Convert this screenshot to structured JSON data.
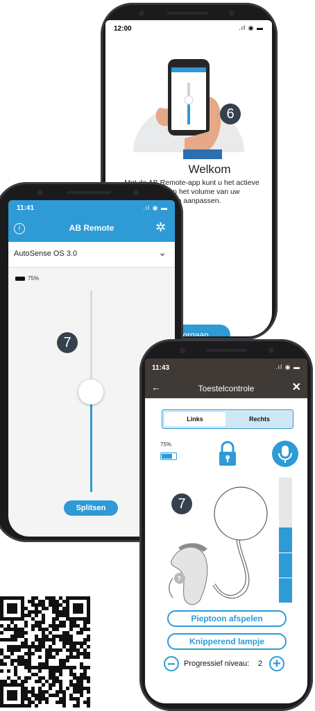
{
  "colors": {
    "accent": "#2e9ad6",
    "header_dark": "#403a36",
    "callout": "#35424d"
  },
  "phone1": {
    "time": "12:00",
    "welcome_title": "Welkom",
    "welcome_text_line1": "Met de AB Remote-app kunt u het actieve",
    "welcome_text_line2": "…ellen en het volume van uw",
    "welcome_text_line3": "…llen aanpassen.",
    "callout": "6",
    "continue_button": "Doorgaan"
  },
  "phone2": {
    "time": "11:41",
    "app_title": "AB Remote",
    "program_select": "AutoSense OS 3.0",
    "battery_pct": "75%",
    "volume_level": 0.58,
    "callout": "7",
    "split_button": "Splitsen",
    "icons": [
      "info-icon",
      "settings-gear-icon",
      "chevron-down-icon",
      "battery-icon"
    ]
  },
  "phone3": {
    "time": "11:43",
    "title": "Toestelcontrole",
    "tabs": [
      "Links",
      "Rechts"
    ],
    "active_tab": "Links",
    "battery_pct": "75%",
    "callout": "7",
    "level_segments_filled": 3,
    "level_segments_total": 5,
    "beep_button": "Pieptoon afspelen",
    "blink_button": "Knipperend lampje",
    "progressive_label": "Progressief niveau:",
    "progressive_value": "2",
    "icons": [
      "back-arrow-icon",
      "close-icon",
      "lock-icon",
      "microphone-icon",
      "minus-icon",
      "plus-icon"
    ]
  },
  "qr": {
    "label": "qr-code"
  }
}
